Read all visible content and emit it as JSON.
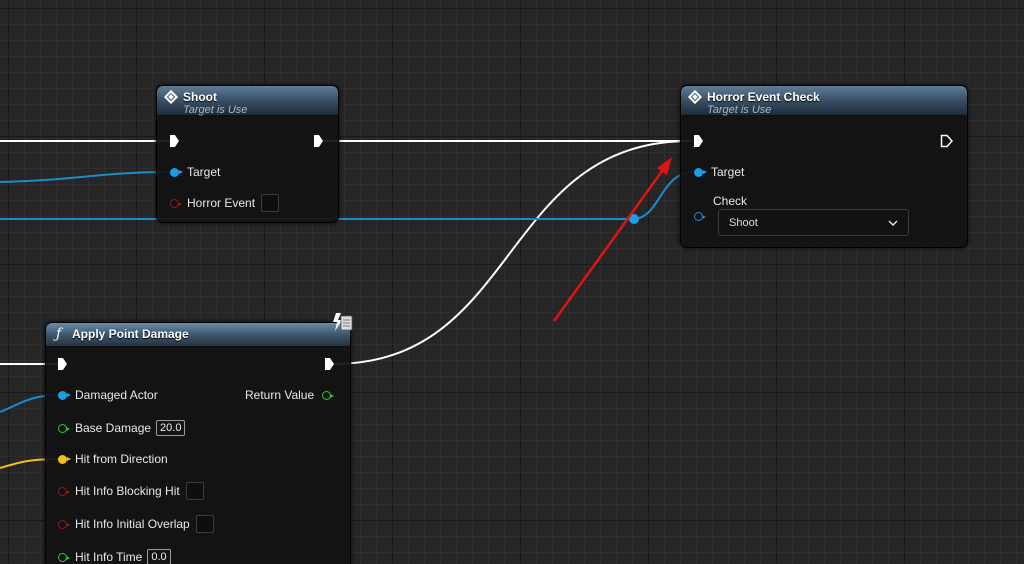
{
  "nodes": {
    "shoot": {
      "title": "Shoot",
      "subtitle": "Target is Use",
      "pins": {
        "target": "Target",
        "horror_event": "Horror Event"
      }
    },
    "horror_event_check": {
      "title": "Horror Event Check",
      "subtitle": "Target is Use",
      "pins": {
        "target": "Target",
        "check": "Check"
      },
      "check_dropdown": {
        "selected": "Shoot",
        "icon": "chevron-down-icon"
      }
    },
    "apply_point_damage": {
      "title": "Apply Point Damage",
      "icon": "function-icon",
      "pins": {
        "damaged_actor": "Damaged Actor",
        "return_value": "Return Value",
        "base_damage": "Base Damage",
        "base_damage_value": "20.0",
        "hit_from_direction": "Hit from Direction",
        "hit_info_blocking_hit": "Hit Info Blocking Hit",
        "hit_info_initial_overlap": "Hit Info Initial Overlap",
        "hit_info_time": "Hit Info Time",
        "hit_info_time_value": "0.0"
      }
    }
  },
  "colors": {
    "exec_wire": "#ffffff",
    "object_wire": "#1a9ee6",
    "vector_wire": "#f2c019",
    "annotation_arrow": "#e01414",
    "boolean_pin": "#931a1a",
    "float_pin": "#2dc92d"
  }
}
